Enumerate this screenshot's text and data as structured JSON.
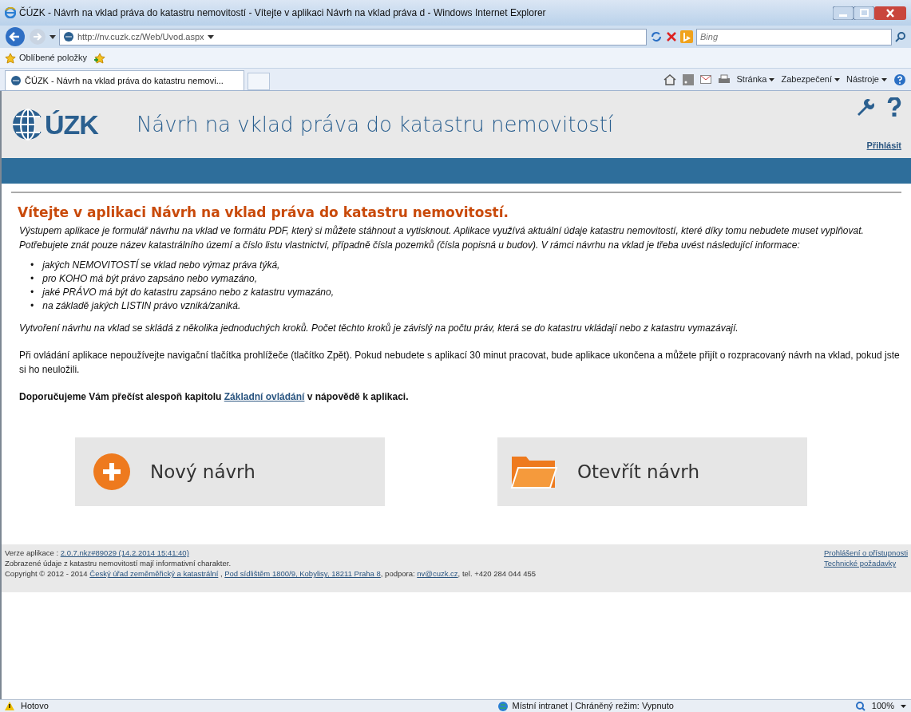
{
  "window": {
    "title": "ČÚZK - Návrh na vklad práva do katastru nemovitostí - Vítejte v aplikaci Návrh na vklad práva d - Windows Internet Explorer"
  },
  "address_bar": {
    "url": "http://nv.cuzk.cz/Web/Uvod.aspx"
  },
  "search": {
    "placeholder": "Bing"
  },
  "favorites": {
    "label": "Oblíbené položky"
  },
  "tabs": [
    {
      "label": "ČÚZK - Návrh na vklad práva do katastru nemovi...",
      "selected": true
    }
  ],
  "command_bar": [
    "Stránka",
    "Zabezpečení",
    "Nástroje"
  ],
  "header": {
    "logo": "ÚZK",
    "title": "Návrh na vklad práva do katastru nemovitostí",
    "login": "Přihlásit"
  },
  "content": {
    "heading": "Vítejte v aplikaci Návrh na vklad práva do katastru nemovitostí.",
    "intro": "Výstupem aplikace je formulář návrhu na vklad ve formátu PDF, který si můžete stáhnout a vytisknout. Aplikace využívá aktuální údaje katastru nemovitostí, které díky tomu nebudete muset vyplňovat. Potřebujete znát pouze název katastrálního území a číslo listu vlastnictví, případně čísla pozemků (čísla popisná u budov). V rámci návrhu na vklad je třeba uvést následující informace:",
    "bullets": [
      {
        "marker": "•",
        "text": "jakých NEMOVITOSTÍ se vklad nebo výmaz práva týká,"
      },
      {
        "marker": "•",
        "text": "pro KOHO má být právo zapsáno nebo vymazáno,"
      },
      {
        "marker": "•",
        "text": "jaké PRÁVO má být do katastru zapsáno nebo z katastru vymazáno,"
      },
      {
        "marker": "•",
        "text": "na základě jakých LISTIN právo vzniká/zaniká."
      }
    ],
    "steps": "Vytvoření návrhu na vklad se skládá z několika jednoduchých kroků. Počet těchto kroků je závislý na počtu práv, která se do katastru vkládají nebo z katastru vymazávají.",
    "warning": "Při ovládání aplikace nepoužívejte navigační tlačítka prohlížeče (tlačítko Zpět). Pokud nebudete s aplikací 30 minut pracovat, bude aplikace ukončena a můžete přijít o rozpracovaný návrh na vklad, pokud jste si ho neuložili.",
    "recommend": {
      "before": "Doporučujeme Vám přečíst alespoň kapitolu",
      "link": "Základní ovládání",
      "after": "v nápovědě k aplikaci."
    }
  },
  "actions": [
    {
      "kind": "new",
      "label": "Nový návrh"
    },
    {
      "kind": "open",
      "label": "Otevřít návrh"
    }
  ],
  "footer": {
    "lines": [
      [
        {
          "text": "Verze aplikace : ",
          "link": false
        },
        {
          "text": "2.0.7.nkz#89029 (14.2.2014 15:41:40)",
          "link": true
        }
      ],
      [
        {
          "text": "Zobrazené údaje z katastru nemovitostí mají informativní charakter.",
          "link": false
        }
      ],
      [
        {
          "text": "Copyright © 2012 - 2014 ",
          "link": false
        },
        {
          "text": "Český úřad zeměměřický a katastrální",
          "link": true
        },
        {
          "text": " , ",
          "link": false
        },
        {
          "text": "Pod sídlištěm 1800/9, Kobylisy, 18211 Praha 8",
          "link": true
        },
        {
          "text": ", podpora: ",
          "link": false
        },
        {
          "text": "nv@cuzk.cz",
          "link": true
        },
        {
          "text": ", tel. +420 284 044 455",
          "link": false
        }
      ]
    ],
    "right_links": [
      "Prohlášení o přístupnosti",
      "Technické požadavky"
    ]
  },
  "status_bar": {
    "text": "Hotovo",
    "zone": "Místní intranet | Chráněný režim: Vypnuto",
    "zoom": "100%"
  }
}
